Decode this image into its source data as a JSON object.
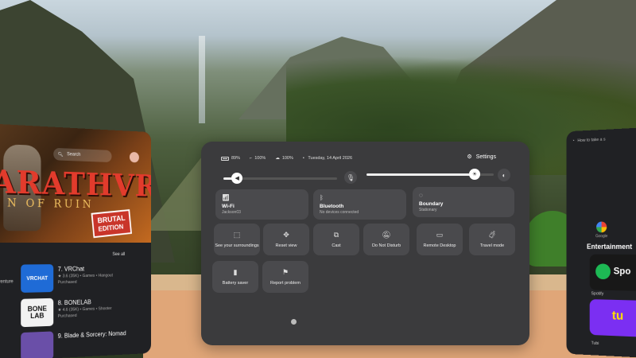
{
  "store": {
    "search_placeholder": "Search",
    "hero_title": "ARATHVR",
    "hero_subtitle": "N OF RUIN",
    "hero_badge": "BRUTAL",
    "hero_badge2": "EDITION",
    "see_all": "See all",
    "side_label": "venture",
    "items": [
      {
        "title": "7. VRChat",
        "meta": "★ 3.6 (35K) • Games • Hangout",
        "status": "Purchased",
        "thumb": "VRCHAT"
      },
      {
        "title": "8. BONELAB",
        "meta": "★ 4.6 (35K) • Games • Shooter",
        "status": "Purchased",
        "thumb": "BONE LAB"
      },
      {
        "title": "9. Blade & Sorcery: Nomad",
        "meta": "",
        "status": "",
        "thumb": ""
      }
    ]
  },
  "quick_settings": {
    "status": {
      "headset_battery": "89%",
      "controller1_battery": "100%",
      "controller2_battery": "100%",
      "date": "Tuesday, 14 April 2026"
    },
    "settings_label": "Settings",
    "volume_level": 0.12,
    "brightness_level": 0.85,
    "wide_tiles": [
      {
        "label": "Wi-Fi",
        "sub": "Jackson03",
        "icon": "wifi-icon"
      },
      {
        "label": "Bluetooth",
        "sub": "No devices connected",
        "icon": "bluetooth-icon"
      },
      {
        "label": "Boundary",
        "sub": "Stationary",
        "icon": "boundary-icon"
      }
    ],
    "tiles": [
      {
        "label": "See your surroundings",
        "icon": "passthrough-icon"
      },
      {
        "label": "Reset view",
        "icon": "reset-view-icon"
      },
      {
        "label": "Cast",
        "icon": "cast-icon"
      },
      {
        "label": "Do Not Disturb",
        "icon": "dnd-icon"
      },
      {
        "label": "Remote Desktop",
        "icon": "remote-desktop-icon"
      },
      {
        "label": "Travel mode",
        "icon": "travel-icon"
      },
      {
        "label": "Battery saver",
        "icon": "battery-saver-icon"
      },
      {
        "label": "Report problem",
        "icon": "report-icon"
      }
    ]
  },
  "right_panel": {
    "search_text": "How to take a s",
    "google_label": "Google",
    "entertainment": "Entertainment",
    "spotify_label": "Spotify",
    "spotify_logo_text": "Spo",
    "tubi_label": "Tubi",
    "tubi_logo_text": "tu"
  }
}
